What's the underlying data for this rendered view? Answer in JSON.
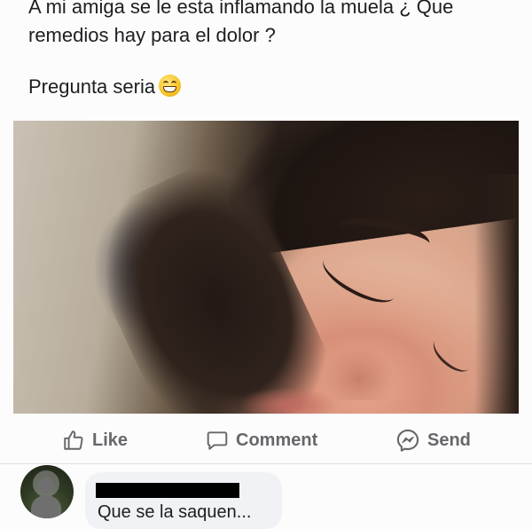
{
  "post": {
    "question": "A mi amiga se le esta inflamando la muela ¿ Que remedios hay para el dolor ?",
    "serious_label": "Pregunta seria",
    "emoji": "grinning-face-with-smiling-eyes-icon"
  },
  "actions": {
    "like_label": "Like",
    "comment_label": "Comment",
    "send_label": "Send"
  },
  "comment": {
    "text": "Que se la saquen..."
  },
  "colors": {
    "action_gray": "#65676b",
    "bubble_bg": "#f0f2f5",
    "text": "#1c1e21"
  }
}
